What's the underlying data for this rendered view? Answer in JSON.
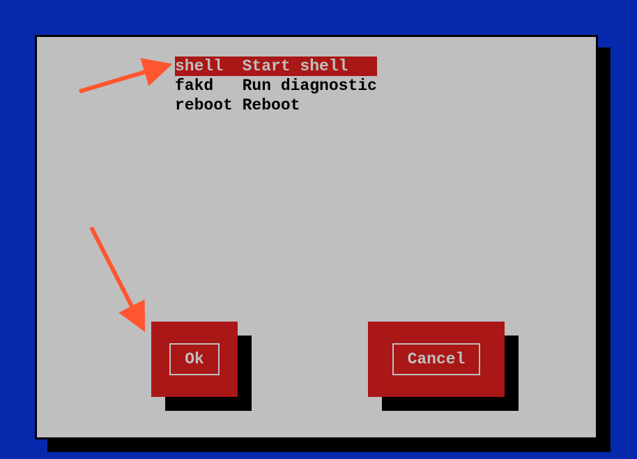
{
  "menu": {
    "items": [
      {
        "key": "shell",
        "desc": "Start shell",
        "pad": "   ",
        "selected": true
      },
      {
        "key": "fakd",
        "desc": "Run diagnostic",
        "pad": "",
        "selected": false
      },
      {
        "key": "reboot",
        "desc": "Reboot",
        "pad": "",
        "selected": false
      }
    ]
  },
  "buttons": {
    "ok": "Ok",
    "cancel": "Cancel"
  },
  "colors": {
    "background": "#0628ac",
    "dialog": "#bfbfbf",
    "accent": "#aa1717",
    "shadow": "#000000",
    "arrow": "#ff5630"
  }
}
